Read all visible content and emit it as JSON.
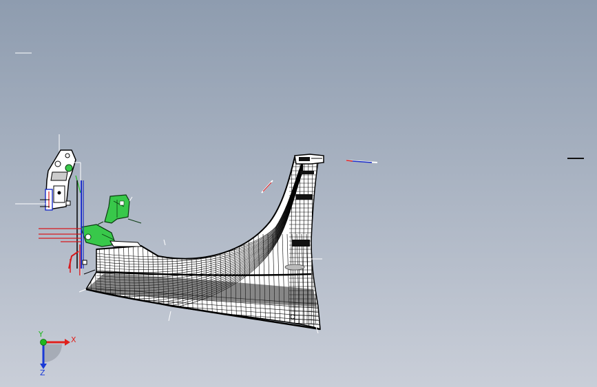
{
  "viewport": {
    "background_top": "#8e9caf",
    "background_bottom": "#c9ced8"
  },
  "triad": {
    "x_label": "X",
    "y_label": "Y",
    "z_label": "Z",
    "x_color": "#e0201c",
    "y_color": "#1fb81f",
    "z_color": "#1a3ad6"
  },
  "model": {
    "mesh_color": "#000000",
    "face_color": "#ffffff",
    "bracket_color": "#38c84a",
    "pipe_red": "#d8181c",
    "pipe_blue": "#1a2cc8"
  }
}
